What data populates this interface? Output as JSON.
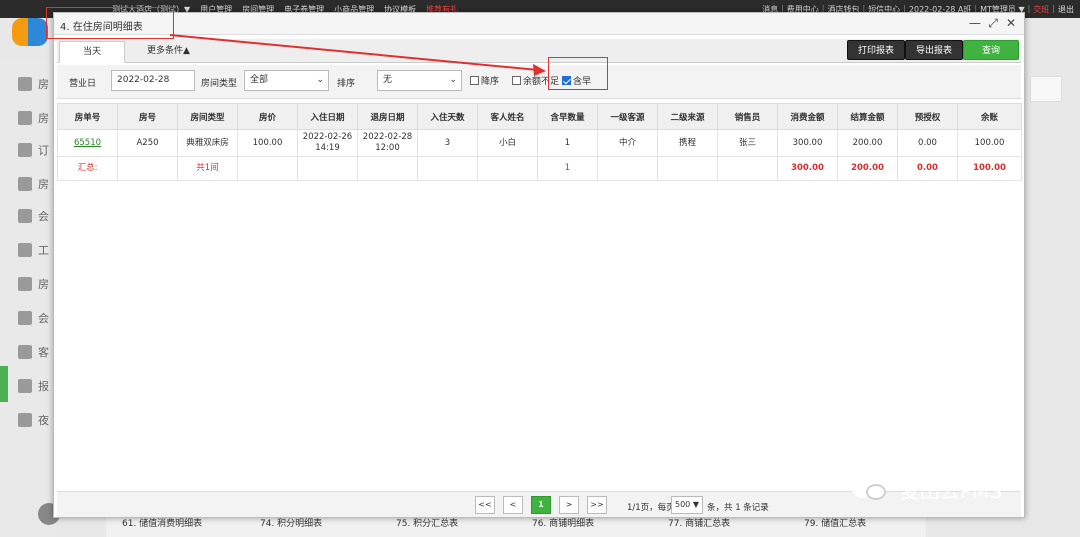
{
  "topbar": {
    "nav": [
      "测试大酒店（测试）▼",
      "用户管理",
      "房间管理",
      "电子券管理",
      "小商品管理",
      "协议模板",
      "推荐有礼"
    ],
    "right": [
      "消息",
      "费用中心",
      "酒店钱包",
      "短信中心",
      "2022-02-28 A班",
      "MT管理员 ▼",
      "交班",
      "退出"
    ]
  },
  "sidebar": {
    "items": [
      "房",
      "房",
      "订",
      "房",
      "会",
      "工",
      "房",
      "会",
      "客",
      "报",
      "夜"
    ]
  },
  "bottom_bar": {
    "items": [
      "61. 储值消费明细表",
      "74. 积分明细表",
      "75. 积分汇总表",
      "76. 商铺明细表",
      "77. 商铺汇总表",
      "79. 储值汇总表"
    ]
  },
  "watermark": {
    "text": "麦田云PMS"
  },
  "modal": {
    "title": "4. 在住房间明细表",
    "win_controls": {
      "minimize": "—",
      "maximize": "⤢",
      "close": "✕"
    },
    "tabs": [
      "当天",
      "更多条件▲"
    ],
    "buttons": {
      "print": "打印报表",
      "export": "导出报表",
      "query": "查询"
    },
    "filters": {
      "date_label": "营业日",
      "date_value": "2022-02-28",
      "room_type_label": "房间类型",
      "room_type_value": "全部",
      "sort_label": "排序",
      "sort_value": "无",
      "desc_label": "降序",
      "desc_checked": false,
      "balance_label": "余额不足",
      "balance_checked": false,
      "breakfast_label": "含早",
      "breakfast_checked": true
    },
    "table": {
      "headers": [
        "房单号",
        "房号",
        "房间类型",
        "房价",
        "入住日期",
        "退房日期",
        "入住天数",
        "客人姓名",
        "含早数量",
        "一级客源",
        "二级来源",
        "销售员",
        "消费金额",
        "结算金额",
        "预授权",
        "余账"
      ],
      "rows": [
        [
          "65510",
          "A250",
          "典雅双床房",
          "100.00",
          "2022-02-26 14:19",
          "2022-02-28 12:00",
          "3",
          "小白",
          "1",
          "中介",
          "携程",
          "张三",
          "300.00",
          "200.00",
          "0.00",
          "100.00"
        ]
      ],
      "total": {
        "label": "汇总:",
        "rooms": "共1间",
        "breakfast": "1",
        "consume": "300.00",
        "settle": "200.00",
        "preauth": "0.00",
        "balance": "100.00"
      }
    },
    "pager": {
      "first": "<<",
      "prev": "<",
      "current": "1",
      "next": ">",
      "last": ">>",
      "page_info": "1/1页，每页",
      "page_size": "500",
      "count_info": "条，共 1 条记录"
    }
  },
  "colors": {
    "accent_green": "#3fb23f",
    "annotation_red": "#e03030",
    "link_green": "#2a8a2a",
    "total_red": "#d63030"
  }
}
